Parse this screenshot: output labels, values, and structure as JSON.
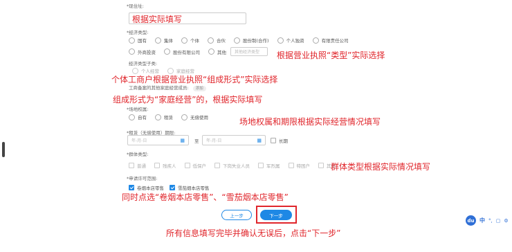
{
  "address": {
    "label": "*现住址:",
    "annotation": "根据实际填写"
  },
  "economic_type": {
    "label": "*经济类型:",
    "options_row1": [
      "国有",
      "集体",
      "个体",
      "合伙",
      "股份制(合作)",
      "个人独资",
      "有限责任公司"
    ],
    "options_row2": [
      "外商投资",
      "股份有限公司",
      "其他"
    ],
    "other_placeholder": "其他经济类型",
    "annotation": "根据营业执照“类型”实际选择"
  },
  "economic_subtype": {
    "label": "经济类型子类:",
    "options": [
      "个人经营",
      "家庭经营"
    ],
    "annotation": "个体工商户根据营业执照“组成形式”实际选择"
  },
  "business_form": {
    "label": "工商备案的其他家庭经营成员:",
    "tag": "添加",
    "annotation": "组成形式为“家庭经营”的，根据实际填写"
  },
  "site_ownership": {
    "label": "*场地权属:",
    "options": [
      "自有",
      "租赁",
      "无偿使用"
    ],
    "annotation": "场地权属和期限根据实际经营情况填写"
  },
  "lease_period": {
    "label": "*租赁（无偿使用）期限:",
    "start_placeholder": "年-月-日",
    "to": "至",
    "end_placeholder": "年-月-日",
    "long_term": "长期"
  },
  "group_type": {
    "label": "*群体类型:",
    "options": [
      "普通",
      "残疾人",
      "低保户",
      "下岗失业人员",
      "军烈属",
      "特困户",
      "其他"
    ],
    "annotation": "群体类型根据实际情况填写"
  },
  "permit_scope": {
    "label": "*申请许可范围:",
    "options": [
      "卷烟本店零售",
      "雪茄烟本店零售"
    ],
    "annotation": "同时点选“卷烟本店零售”、“雪茄烟本店零售”"
  },
  "buttons": {
    "prev": "上一步",
    "next": "下一步"
  },
  "bottom_annotation": "所有信息填写完毕并确认无误后，点击“下一步”",
  "widget": {
    "logo": "du",
    "items": [
      "中",
      "°,",
      "▢",
      "⚙"
    ]
  },
  "colors": {
    "annotation": "#e0252b",
    "primary": "#1e88e5",
    "highlight": "#e0252b"
  }
}
